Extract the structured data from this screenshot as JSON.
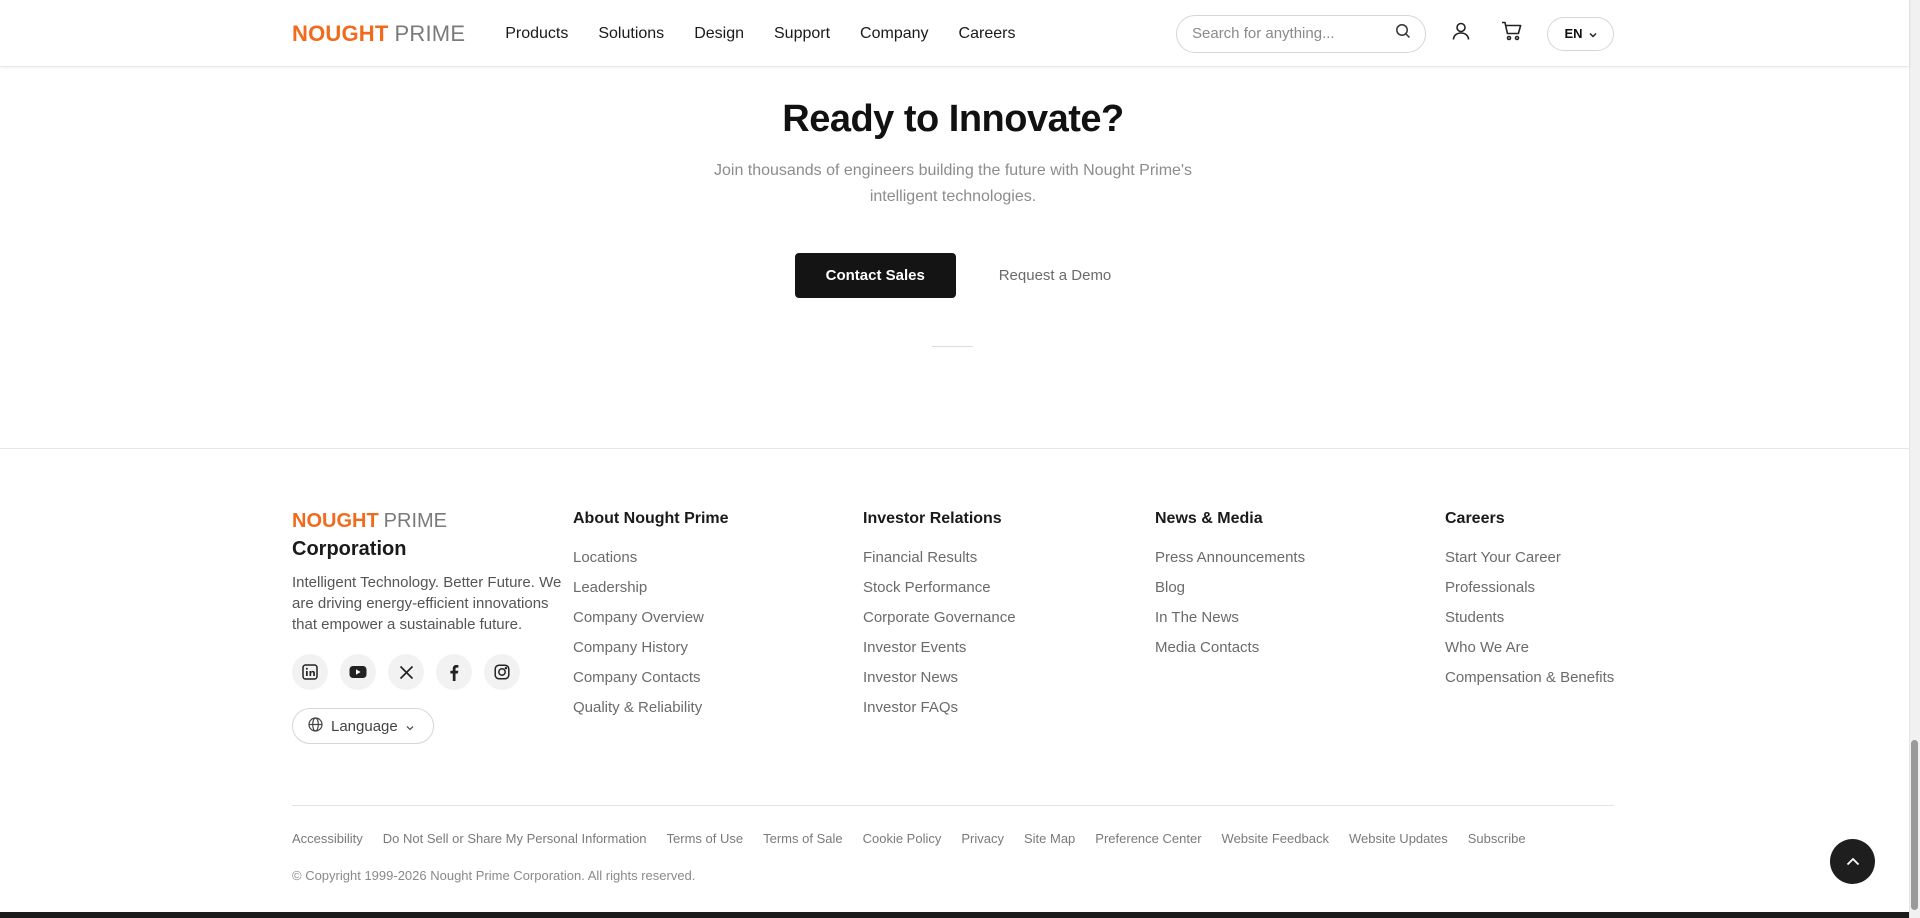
{
  "header": {
    "logo_primary": "NOUGHT",
    "logo_secondary": "PRIME",
    "nav": [
      "Products",
      "Solutions",
      "Design",
      "Support",
      "Company",
      "Careers"
    ],
    "search_placeholder": "Search for anything...",
    "language_code": "EN",
    "icons": [
      "search-icon",
      "user-icon",
      "cart-icon",
      "chevron-down-icon"
    ]
  },
  "cta": {
    "title": "Ready to Innovate?",
    "subtitle_line1": "Join thousands of engineers building the future with Nought Prime's",
    "subtitle_line2": "intelligent technologies.",
    "primary_button": "Contact Sales",
    "secondary_button": "Request a Demo"
  },
  "footer": {
    "logo_primary": "NOUGHT",
    "logo_secondary": "PRIME",
    "corp": "Corporation",
    "tagline": "Intelligent Technology. Better Future. We are driving energy-efficient innovations that empower a sustainable future.",
    "socials": [
      "linkedin-icon",
      "youtube-icon",
      "x-icon",
      "facebook-icon",
      "instagram-icon"
    ],
    "language_button": "Language",
    "columns": [
      {
        "title": "About Nought Prime",
        "links": [
          "Locations",
          "Leadership",
          "Company Overview",
          "Company History",
          "Company Contacts",
          "Quality & Reliability"
        ]
      },
      {
        "title": "Investor Relations",
        "links": [
          "Financial Results",
          "Stock Performance",
          "Corporate Governance",
          "Investor Events",
          "Investor News",
          "Investor FAQs"
        ]
      },
      {
        "title": "News & Media",
        "links": [
          "Press Announcements",
          "Blog",
          "In The News",
          "Media Contacts"
        ]
      },
      {
        "title": "Careers",
        "links": [
          "Start Your Career",
          "Professionals",
          "Students",
          "Who We Are",
          "Compensation & Benefits"
        ]
      }
    ],
    "legal_links": [
      "Accessibility",
      "Do Not Sell or Share My Personal Information",
      "Terms of Use",
      "Terms of Sale",
      "Cookie Policy",
      "Privacy",
      "Site Map",
      "Preference Center",
      "Website Feedback",
      "Website Updates",
      "Subscribe"
    ],
    "copyright": "© Copyright 1999-2026 Nought Prime Corporation. All rights reserved."
  },
  "colors": {
    "brand_orange": "#f26b1d",
    "dark": "#141414",
    "muted_text": "#6b6b6b"
  }
}
